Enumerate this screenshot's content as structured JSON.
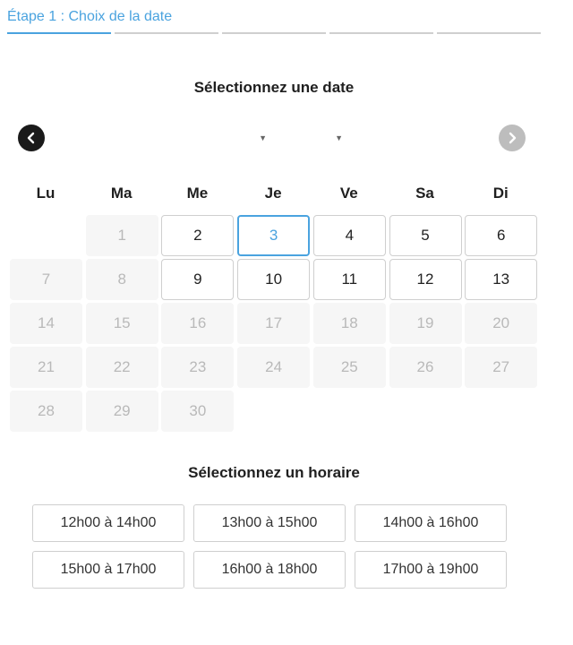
{
  "steps": {
    "current_label": "Étape 1 : Choix de la date",
    "count": 5,
    "active_index": 0
  },
  "calendar": {
    "title": "Sélectionnez une date",
    "month_select": {
      "value": ""
    },
    "year_select": {
      "value": ""
    },
    "weekdays": [
      "Lu",
      "Ma",
      "Me",
      "Je",
      "Ve",
      "Sa",
      "Di"
    ],
    "weeks": [
      [
        null,
        {
          "day": "1",
          "state": "disabled"
        },
        {
          "day": "2",
          "state": "available"
        },
        {
          "day": "3",
          "state": "selected"
        },
        {
          "day": "4",
          "state": "available"
        },
        {
          "day": "5",
          "state": "available"
        },
        {
          "day": "6",
          "state": "available"
        }
      ],
      [
        {
          "day": "7",
          "state": "disabled"
        },
        {
          "day": "8",
          "state": "disabled"
        },
        {
          "day": "9",
          "state": "available"
        },
        {
          "day": "10",
          "state": "available"
        },
        {
          "day": "11",
          "state": "available"
        },
        {
          "day": "12",
          "state": "available"
        },
        {
          "day": "13",
          "state": "available"
        }
      ],
      [
        {
          "day": "14",
          "state": "disabled"
        },
        {
          "day": "15",
          "state": "disabled"
        },
        {
          "day": "16",
          "state": "disabled"
        },
        {
          "day": "17",
          "state": "disabled"
        },
        {
          "day": "18",
          "state": "disabled"
        },
        {
          "day": "19",
          "state": "disabled"
        },
        {
          "day": "20",
          "state": "disabled"
        }
      ],
      [
        {
          "day": "21",
          "state": "disabled"
        },
        {
          "day": "22",
          "state": "disabled"
        },
        {
          "day": "23",
          "state": "disabled"
        },
        {
          "day": "24",
          "state": "disabled"
        },
        {
          "day": "25",
          "state": "disabled"
        },
        {
          "day": "26",
          "state": "disabled"
        },
        {
          "day": "27",
          "state": "disabled"
        }
      ],
      [
        {
          "day": "28",
          "state": "disabled"
        },
        {
          "day": "29",
          "state": "disabled"
        },
        {
          "day": "30",
          "state": "disabled"
        },
        null,
        null,
        null,
        null
      ]
    ],
    "colors": {
      "accent": "#4aa3df",
      "prev_button": "#1a1a1a",
      "next_button": "#bdbdbd"
    }
  },
  "time": {
    "title": "Sélectionnez un horaire",
    "slots": [
      "12h00 à 14h00",
      "13h00 à 15h00",
      "14h00 à 16h00",
      "15h00 à 17h00",
      "16h00 à 18h00",
      "17h00 à 19h00"
    ]
  }
}
